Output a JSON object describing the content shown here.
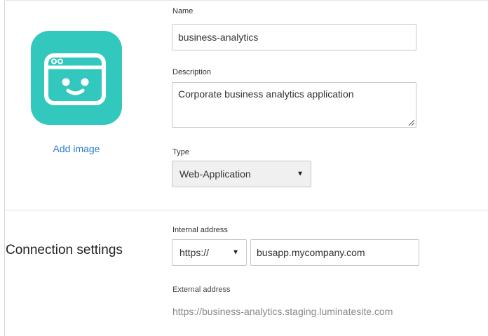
{
  "app": {
    "icon_name": "app-window-smile-icon",
    "icon_color": "#33c8bd",
    "add_image_label": "Add image",
    "link_color": "#2a7bd1"
  },
  "general": {
    "name_label": "Name",
    "name_value": "business-analytics",
    "description_label": "Description",
    "description_value": "Corporate business analytics application",
    "type_label": "Type",
    "type_value": "Web-Application"
  },
  "connection": {
    "section_title": "Connection settings",
    "internal_address_label": "Internal address",
    "protocol_value": "https://",
    "internal_address_value": "busapp.mycompany.com",
    "external_address_label": "External address",
    "external_address_value": "https://business-analytics.staging.luminatesite.com"
  },
  "icons": {
    "dropdown": "caret-down-icon",
    "resize": "resize-grip-icon"
  }
}
